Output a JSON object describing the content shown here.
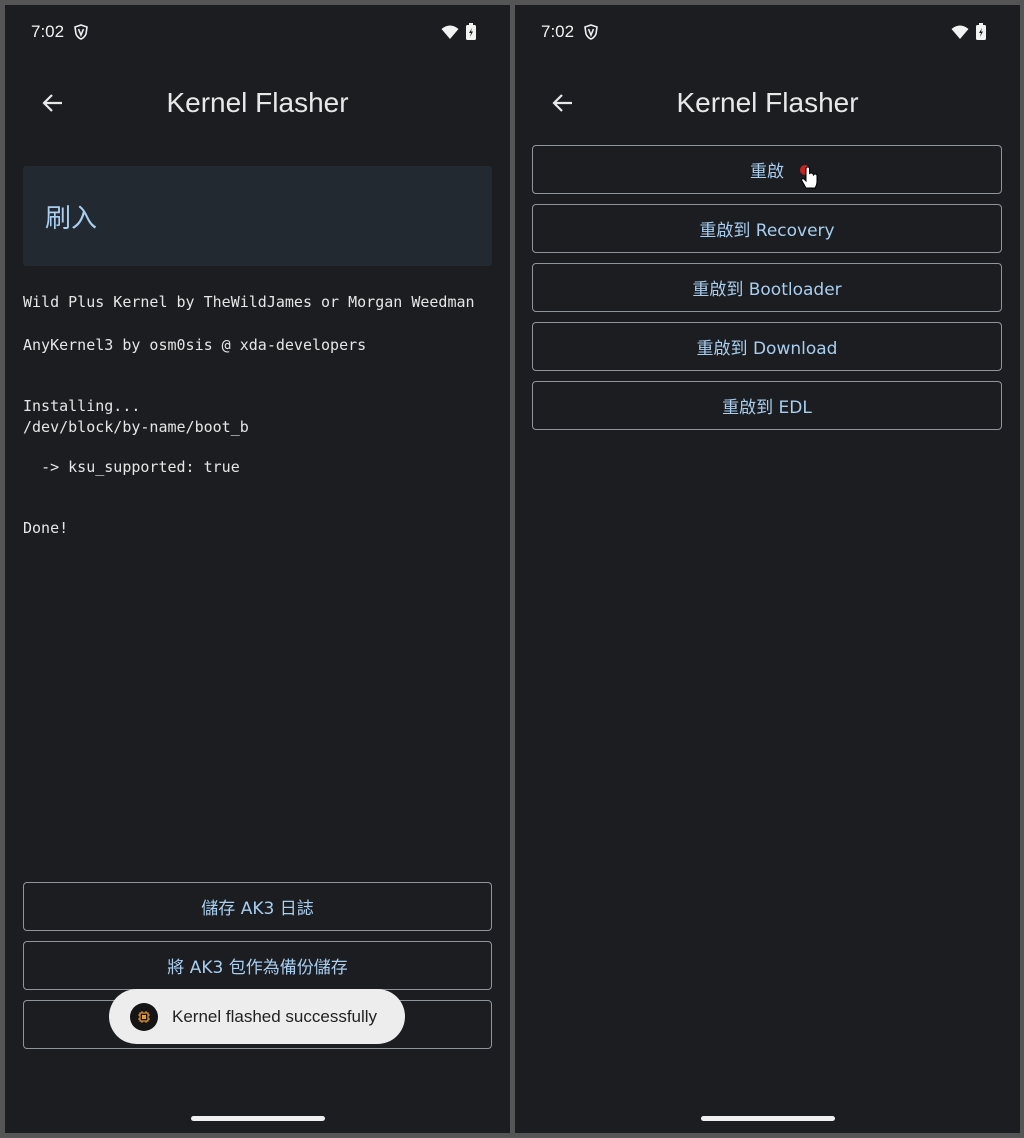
{
  "left": {
    "status": {
      "time": "7:02"
    },
    "app_title": "Kernel Flasher",
    "card_title": "刷入",
    "log_lines": [
      "Wild Plus Kernel by TheWildJames or Morgan Weedman",
      "AnyKernel3 by osm0sis @ xda-developers",
      "Installing...\n/dev/block/by-name/boot_b",
      "  -> ksu_supported: true",
      "Done!"
    ],
    "buttons": {
      "save_log": "儲存 AK3 日誌",
      "backup": "將 AK3 包作為備份儲存"
    },
    "toast": "Kernel flashed successfully"
  },
  "right": {
    "status": {
      "time": "7:02"
    },
    "app_title": "Kernel Flasher",
    "buttons": {
      "reboot": "重啟",
      "reboot_recovery": "重啟到 Recovery",
      "reboot_bootloader": "重啟到 Bootloader",
      "reboot_download": "重啟到 Download",
      "reboot_edl": "重啟到 EDL"
    }
  },
  "colors": {
    "background": "#1b1d21",
    "accent": "#a8cef0",
    "card": "#232930",
    "outline": "#8f959c",
    "toast_bg": "#ededed"
  }
}
